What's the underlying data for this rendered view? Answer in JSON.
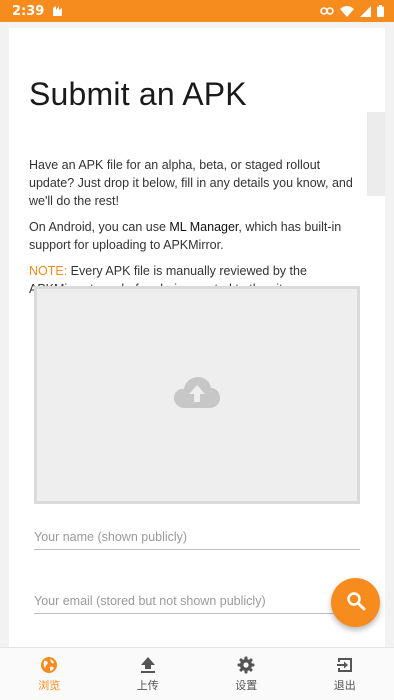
{
  "status_bar": {
    "time": "2:39",
    "icons": [
      "notification-icon",
      "link-icon",
      "wifi-icon",
      "signal-icon",
      "battery-icon"
    ]
  },
  "page": {
    "title": "Submit an APK",
    "intro": "Have an APK file for an alpha, beta, or staged rollout update? Just drop it below, fill in any details you know, and we'll do the rest!",
    "android_prefix": "On Android, you can use ",
    "ml_manager": "ML Manager",
    "android_suffix": ", which has built-in support for uploading to APKMirror.",
    "note_label": "NOTE:",
    "note_text": " Every APK file is manually reviewed by the APKMirror team before being posted to the site.",
    "dropzone_icon": "cloud-upload-icon"
  },
  "form": {
    "name_placeholder": "Your name (shown publicly)",
    "email_placeholder": "Your email (stored but not shown publicly)"
  },
  "fab": {
    "icon": "search-icon"
  },
  "bottom_nav": {
    "items": [
      {
        "label": "浏览",
        "icon": "globe-icon",
        "active": true
      },
      {
        "label": "上传",
        "icon": "upload-icon",
        "active": false
      },
      {
        "label": "设置",
        "icon": "gear-icon",
        "active": false
      },
      {
        "label": "退出",
        "icon": "exit-icon",
        "active": false
      }
    ]
  },
  "colors": {
    "accent": "#f68b1e",
    "background": "#f2f2f2",
    "card": "#ffffff"
  }
}
